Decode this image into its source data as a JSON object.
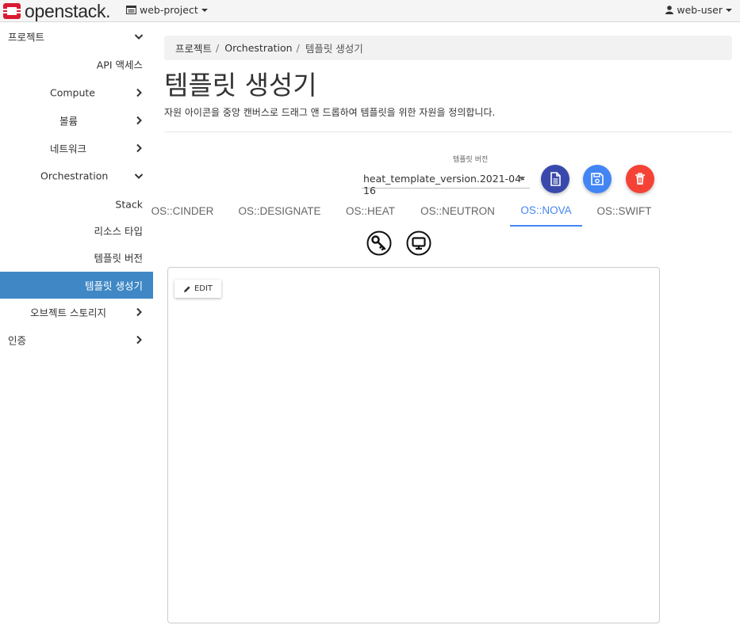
{
  "topbar": {
    "brand": "openstack.",
    "project": "web-project",
    "user": "web-user"
  },
  "sidebar": {
    "items": [
      {
        "label": "프로젝트",
        "chevron": "down"
      },
      {
        "label": "API 액세스",
        "chevron": ""
      },
      {
        "label": "Compute",
        "chevron": "right"
      },
      {
        "label": "볼륨",
        "chevron": "right"
      },
      {
        "label": "네트워크",
        "chevron": "right"
      },
      {
        "label": "Orchestration",
        "chevron": "down"
      },
      {
        "label": "Stack",
        "chevron": ""
      },
      {
        "label": "리소스 타입",
        "chevron": ""
      },
      {
        "label": "템플릿 버전",
        "chevron": ""
      },
      {
        "label": "템플릿 생성기",
        "chevron": "",
        "active": true
      },
      {
        "label": "오브젝트 스토리지",
        "chevron": "right"
      },
      {
        "label": "인증",
        "chevron": "right"
      }
    ]
  },
  "breadcrumb": {
    "items": [
      "프로젝트",
      "Orchestration",
      "템플릿 생성기"
    ],
    "separator": "/"
  },
  "page": {
    "title": "템플릿 생성기",
    "description": "자원 아이콘을 중앙 캔버스로 드래그 앤 드롭하여 템플릿을 위한 자원을 정의합니다."
  },
  "template_version": {
    "label": "템플릿 버전",
    "value": "heat_template_version.2021-04-16"
  },
  "actions": [
    {
      "name": "view-template-button",
      "icon": "file-icon",
      "color": "#3949ab"
    },
    {
      "name": "save-template-button",
      "icon": "floppy-disk-icon",
      "color": "#4285f4"
    },
    {
      "name": "delete-template-button",
      "icon": "trash-icon",
      "color": "#f44336"
    }
  ],
  "tabs": [
    {
      "label": "OS::CINDER",
      "active": false
    },
    {
      "label": "OS::DESIGNATE",
      "active": false
    },
    {
      "label": "OS::HEAT",
      "active": false
    },
    {
      "label": "OS::NEUTRON",
      "active": false
    },
    {
      "label": "OS::NOVA",
      "active": true
    },
    {
      "label": "OS::SWIFT",
      "active": false
    }
  ],
  "resource_icons": [
    {
      "name": "keypair-resource-icon",
      "icon": "key-icon"
    },
    {
      "name": "server-resource-icon",
      "icon": "monitor-icon"
    }
  ],
  "canvas": {
    "edit_label": "EDIT"
  },
  "colors": {
    "accent": "#4285f4",
    "sidebar_active": "#3f88c5",
    "brand": "#da1a32"
  }
}
